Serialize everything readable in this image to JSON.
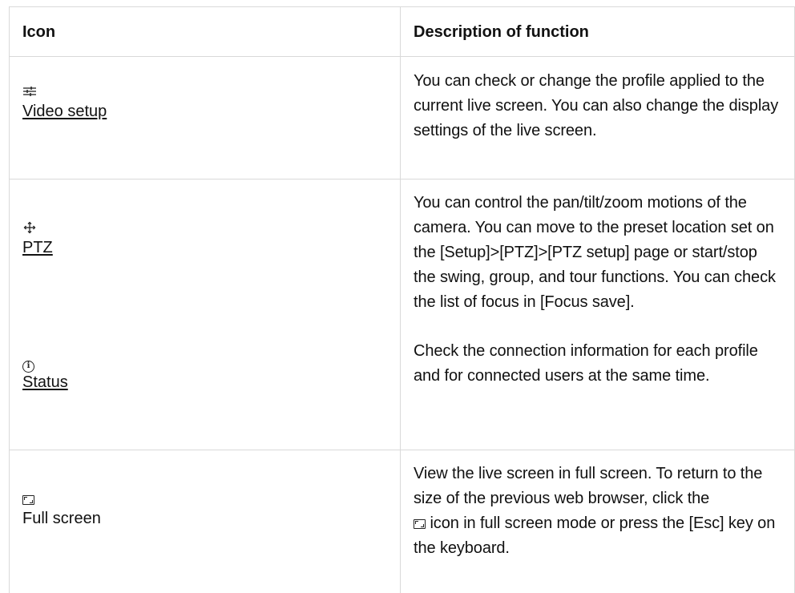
{
  "header": {
    "icon_col": "Icon",
    "desc_col": "Description of function"
  },
  "rows": [
    {
      "icon": "sliders-icon",
      "label": "Video setup",
      "description": "You can check or change the profile applied to the current live screen. You can also change the display settings of the live screen."
    },
    {
      "icon": "move-arrows-icon",
      "label": "PTZ",
      "description": "You can control the pan/tilt/zoom motions of the camera. You can move to the preset location set on the [Setup]>[PTZ]>[PTZ setup] page or start/stop the swing, group, and tour functions. You can check the list of focus in [Focus save]."
    },
    {
      "icon": "info-circle-icon",
      "label": "Status",
      "description": "Check the connection information for each profile and for connected users at the same time."
    },
    {
      "icon": "full-screen-icon",
      "label": "Full screen",
      "description_before_icon": "View the live screen in full screen. To return to the size of the previous web browser, click the",
      "description_after_icon": "icon in full screen mode or press the [Esc] key on the keyboard."
    }
  ]
}
